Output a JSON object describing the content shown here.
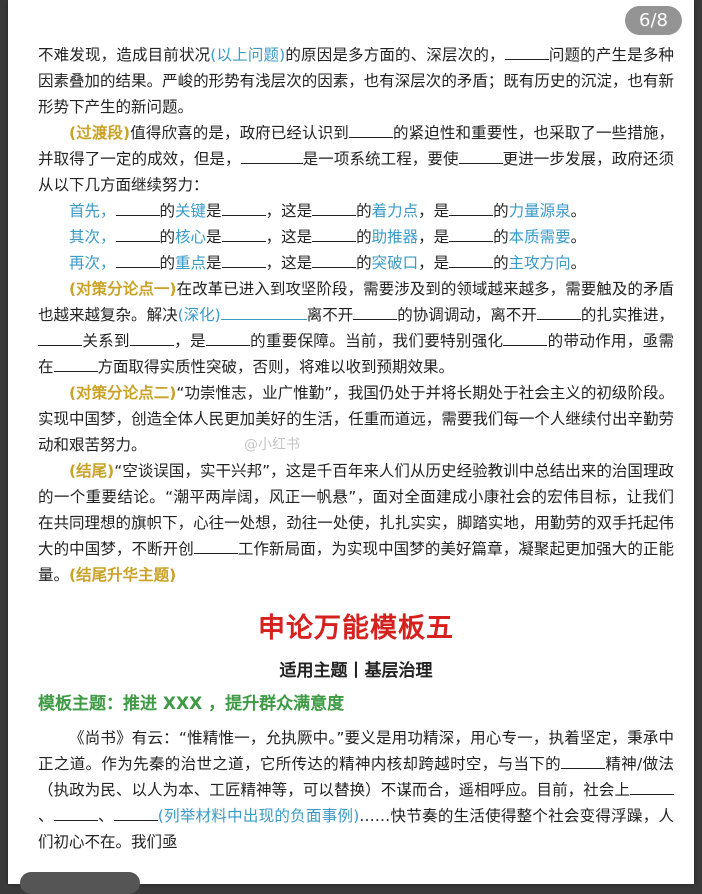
{
  "pager": "6/8",
  "watermark": "@小红书",
  "p1": {
    "t1": "不难发现，造成目前状况",
    "t2": "(以上问题)",
    "t3": "的原因是多方面的、深层次的，",
    "t4": "问题的产生是多种因素叠加的结果。严峻的形势有浅层次的因素，也有深层次的矛盾；既有历史的沉淀，也有新形势下产生的新问题。"
  },
  "p2": {
    "label": "(过渡段)",
    "t1": "值得欣喜的是，政府已经认识到",
    "t2": "的紧迫性和重要性，也采取了一些措施，并取得了一定的成效，但是，",
    "t3": "是一项系统工程，要使",
    "t4": "更进一步发展，政府还须从以下几方面继续努力："
  },
  "rows": [
    {
      "lead": "首先，",
      "mid": "的",
      "k1": "关键",
      "is1": "是",
      "c": "，这是",
      "de": "的",
      "k2": "着力点",
      "is2": "，是",
      "de2": "的",
      "k3": "力量源泉",
      "end": "。"
    },
    {
      "lead": "其次，",
      "mid": "的",
      "k1": "核心",
      "is1": "是",
      "c": "，这是",
      "de": "的",
      "k2": "助推器",
      "is2": "，是",
      "de2": "的",
      "k3": "本质需要",
      "end": "。"
    },
    {
      "lead": "再次，",
      "mid": "的",
      "k1": "重点",
      "is1": "是",
      "c": "，这是",
      "de": "的",
      "k2": "突破口",
      "is2": "，是",
      "de2": "的",
      "k3": "主攻方向",
      "end": "。"
    }
  ],
  "p3": {
    "label": "(对策分论点一)",
    "t1": "在改革已进入到攻坚阶段，需要涉及到的领域越来越多，需要触及的矛盾也越来越复杂。解决",
    "t2": "(深化)",
    "t3": "离不开",
    "t4": "的协调调动，离不开",
    "t5": "的扎实推进，",
    "t6": "关系到",
    "t7": "，是",
    "t8": "的重要保障。当前，我们要特别强化",
    "t9": "的带动作用，亟需在",
    "t10": "方面取得实质性突破，否则，将难以收到预期效果。"
  },
  "p4": {
    "label": "(对策分论点二)",
    "t1": "“功崇惟志，业广惟勤”，我国仍处于并将长期处于社会主义的初级阶段。实现中国梦，创造全体人民更加美好的生活，任重而道远，需要我们每一个人继续付出辛勤劳动和艰苦努力。"
  },
  "p5": {
    "label": "(结尾)",
    "t1": "“空谈误国，实干兴邦”，这是千百年来人们从历史经验教训中总结出来的治国理政的一个重要结论。“潮平两岸阔，风正一帆悬”，面对全面建成小康社会的宏伟目标，让我们在共同理想的旗帜下，心往一处想，劲往一处使，扎扎实实，脚踏实地，用勤劳的双手托起伟大的中国梦，不断开创",
    "t2": "工作新局面，为实现中国梦的美好篇章，凝聚起更加强大的正能量。",
    "t3": "(结尾升华主题)"
  },
  "section": {
    "title": "申论万能模板五",
    "subtitle": "适用主题丨基层治理",
    "theme": "模板主题：推进 XXX ，提升群众满意度"
  },
  "p6": {
    "t1": "《尚书》有云：“惟精惟一，允执厥中。”要义是用功精深，用心专一，执着坚定，秉承中正之道。作为先秦的治世之道，它所传达的精神内核却跨越时空，与当下的",
    "t2": "精神/做法（执政为民、以人为本、工匠精神等，可以替换）不谋而合，遥相呼应。目前，社会上",
    "t3": "、",
    "t4": "、",
    "t5": "(列举材料中出现的负面事例)",
    "t6": "……快节奏的生活使得整个社会变得浮躁，人们初心不在。我们亟"
  }
}
